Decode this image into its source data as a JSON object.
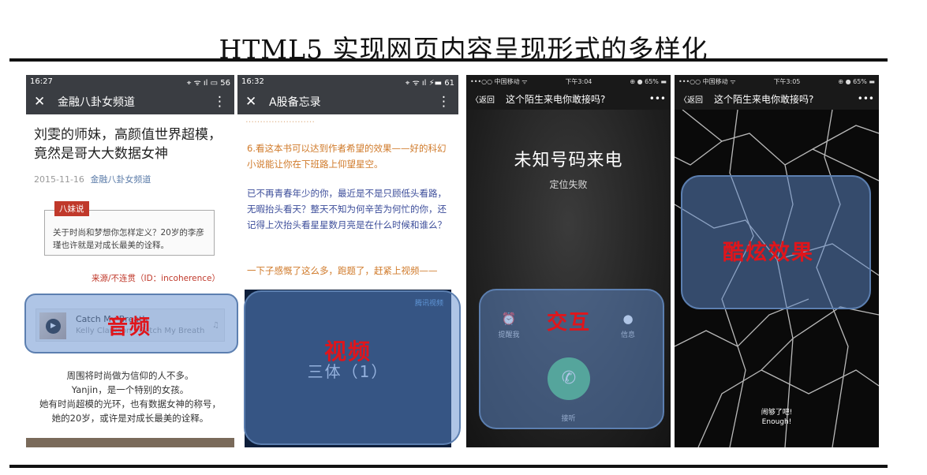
{
  "slide": {
    "title": "HTML5 实现网页内容呈现形式的多样化"
  },
  "phone1": {
    "status_time": "16:27",
    "status_icons": "⌖ ᯤ ıl ▭ 56",
    "nav_close": "✕",
    "nav_title": "金融八卦女频道",
    "nav_more": "⋮",
    "article_title": "刘雯的师妹，高颜值世界超模，竟然是哥大大数据女神",
    "date": "2015-11-16",
    "source": "金融八卦女频道",
    "quote_tag": "八妹说",
    "quote_text": "关于时尚和梦想你怎样定义？20岁的李彦瑾也许就是对成长最美的诠释。",
    "source_line": "来源/不连贯（ID：incoherence）",
    "music_title": "Catch My Breath",
    "music_artist": "Kelly Clarkson - Catch My Breath",
    "body_lines": [
      "周围将时尚做为信仰的人不多。",
      "Yanjin，是一个特别的女孩。",
      "她有时尚超模的光环，也有数据女神的称号，",
      "她的20岁，或许是对成长最美的诠释。"
    ],
    "overlay_label": "音频"
  },
  "phone2": {
    "status_time": "16:32",
    "status_icons": "⌖ ᯤ ıl ⚡▬ 61",
    "nav_close": "✕",
    "nav_title": "A股备忘录",
    "nav_more": "⋮",
    "cut_text": "……………………",
    "orange_para": "6.看这本书可以达到作者希望的效果——好的科幻小说能让你在下班路上仰望星空。",
    "blue_para": "已不再青春年少的你，最近是不是只顾低头看路，无暇抬头看天？整天不知为何辛苦为何忙的你，还记得上次抬头看星星数月亮是在什么时候和谁么？",
    "orange_para2": "一下子感慨了这么多，跑题了，赶紧上视频——",
    "video_title": "三体（1）",
    "video_logo": "腾讯视频",
    "overlay_label": "视频"
  },
  "phone3": {
    "status_left": "•••○○ 中国移动 ᯤ",
    "status_time": "下午3:04",
    "status_right": "⊕ ● 65% ▬",
    "nav_back": "〈返回",
    "nav_title": "这个陌生来电你敢接吗?",
    "nav_more": "•••",
    "call_title": "未知号码来电",
    "call_sub": "定位失败",
    "remind_label": "提醒我",
    "message_label": "信息",
    "answer_label": "接听",
    "overlay_label": "交互"
  },
  "phone4": {
    "status_left": "•••○○ 中国移动 ᯤ",
    "status_time": "下午3:05",
    "status_right": "⊕ ● 65% ▬",
    "nav_back": "〈返回",
    "nav_title": "这个陌生来电你敢接吗?",
    "nav_more": "•••",
    "enough_cn": "闹够了吧!",
    "enough_en": "Enough!",
    "overlay_label": "酷炫效果"
  },
  "colors": {
    "overlay_fill": "#608ccd",
    "overlay_label": "#e0151b",
    "answer_green": "#4bbf6a"
  }
}
